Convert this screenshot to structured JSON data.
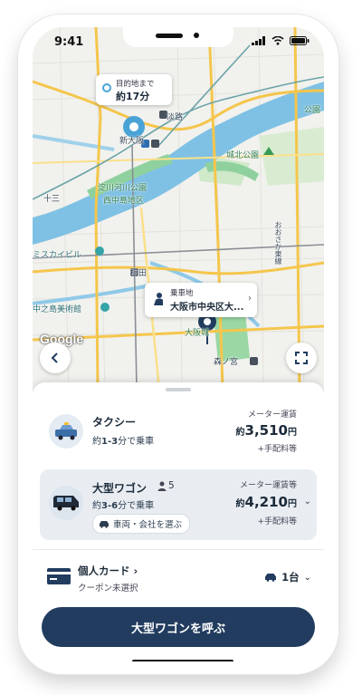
{
  "status_bar": {
    "time": "9:41"
  },
  "map": {
    "destination_callout": {
      "label": "目的地まで",
      "value": "約17分"
    },
    "pickup_callout": {
      "label": "乗車地",
      "value": "大阪市中央区大..."
    },
    "labels": {
      "shin_osaka": "新大阪",
      "awaji": "淡路",
      "jokoku": "城北公園",
      "yodogawa": "淀川河川公園",
      "nishinakajima": "西中島地区",
      "tosu": "十三",
      "sky": "ミスカイビル",
      "umeda": "梅田",
      "nakanoshima": "中之島美術館",
      "osakajo": "大阪城",
      "morinomiya": "森ノ宮",
      "koen": "公園",
      "right_vertical": "おおさか東線"
    },
    "attribution": "Google"
  },
  "rides": [
    {
      "name": "タクシー",
      "eta_prefix": "約",
      "eta_range": "1-3",
      "eta_suffix": "分で乗車",
      "fare_label": "メーター運賃",
      "fare_prefix": "約",
      "fare_value": "3,510",
      "fare_unit": "円",
      "fare_extra": "+手配料等",
      "icon": "taxi-icon"
    },
    {
      "name": "大型ワゴン",
      "seats": "5",
      "eta_prefix": "約",
      "eta_range": "3-6",
      "eta_suffix": "分で乗車",
      "choose_label": "車両・会社を選ぶ",
      "fare_label": "メーター運賃等",
      "fare_prefix": "約",
      "fare_value": "4,210",
      "fare_unit": "円",
      "fare_extra": "+手配料等",
      "icon": "van-icon"
    }
  ],
  "payment": {
    "card": "個人カード",
    "coupon": "クーポン未選択",
    "count": "1台"
  },
  "cta": "大型ワゴンを呼ぶ",
  "colors": {
    "primary": "#213c5f",
    "selected_bg": "#e9edf2",
    "map_water": "#7fc1e4",
    "map_park": "#8fd19e"
  }
}
